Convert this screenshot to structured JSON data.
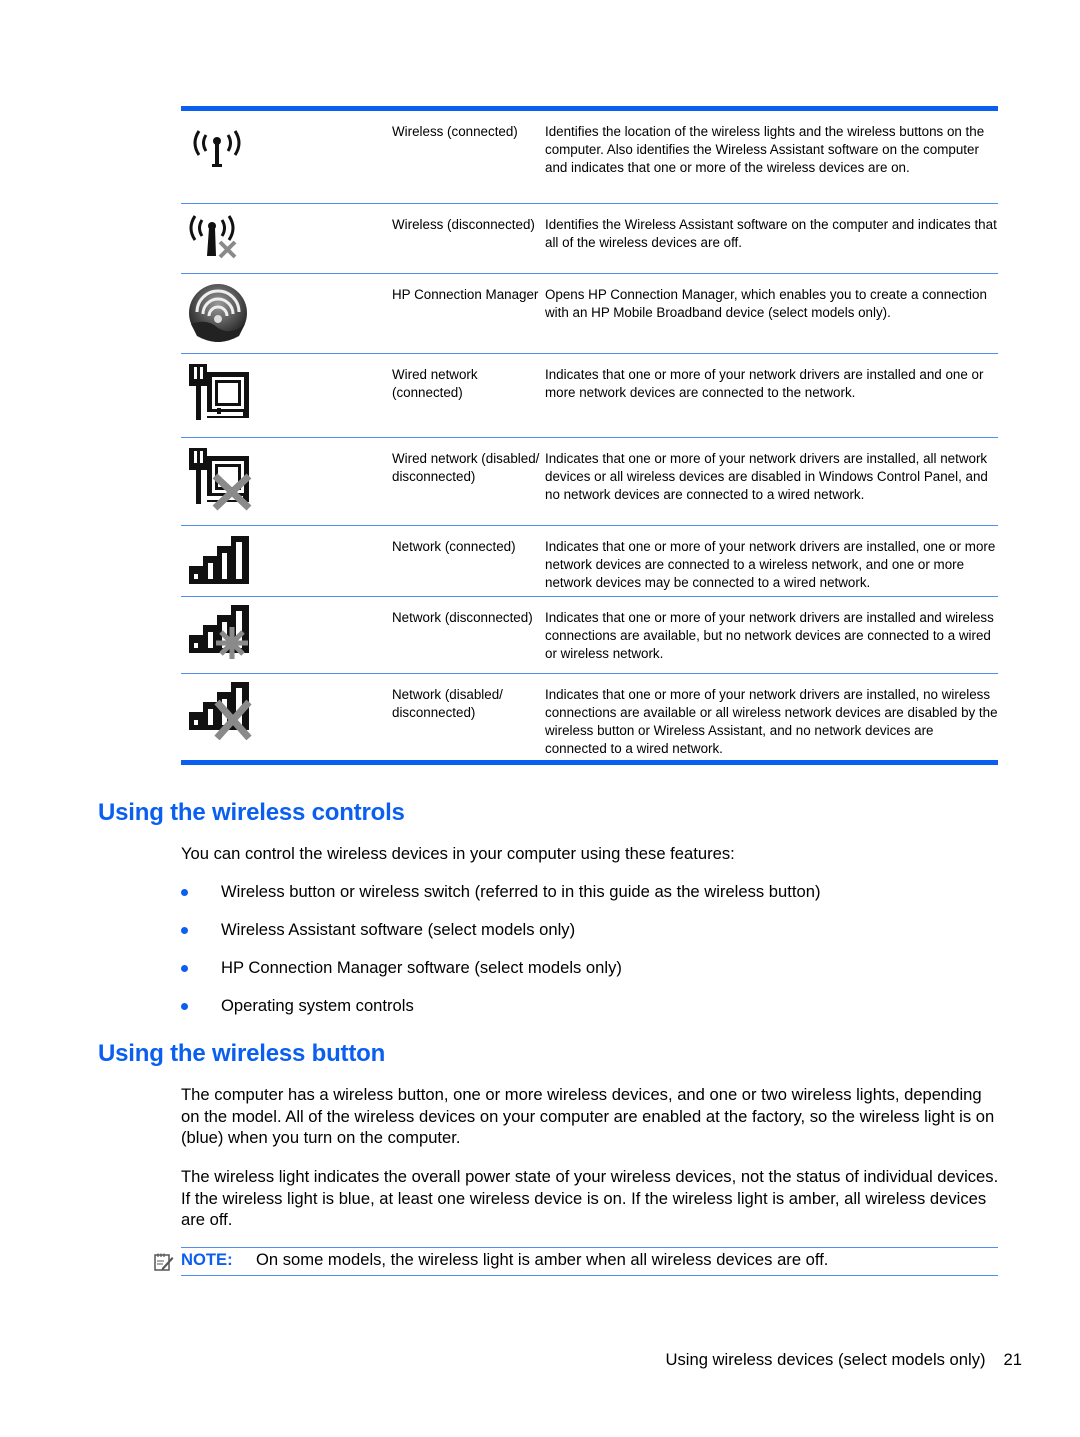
{
  "table": {
    "rows": [
      {
        "icon": "wireless-connected-icon",
        "name": "Wireless (connected)",
        "description": "Identifies the location of the wireless lights and the wireless buttons on the computer. Also identifies the Wireless Assistant software on the computer and indicates that one or more of the wireless devices are on."
      },
      {
        "icon": "wireless-disconnected-icon",
        "name": "Wireless (disconnected)",
        "description": "Identifies the Wireless Assistant software on the computer and indicates that all of the wireless devices are off."
      },
      {
        "icon": "hp-connection-manager-icon",
        "name": "HP Connection Manager",
        "description": "Opens HP Connection Manager, which enables you to create a connection with an HP Mobile Broadband device (select models only)."
      },
      {
        "icon": "wired-network-connected-icon",
        "name": "Wired network (connected)",
        "description": "Indicates that one or more of your network drivers are installed and one or more network devices are connected to the network."
      },
      {
        "icon": "wired-network-disabled-icon",
        "name": "Wired network (disabled/ disconnected)",
        "description": "Indicates that one or more of your network drivers are installed, all network devices or all wireless devices are disabled in Windows Control Panel, and no network devices are connected to a wired network."
      },
      {
        "icon": "network-connected-icon",
        "name": "Network (connected)",
        "description": "Indicates that one or more of your network drivers are installed, one or more network devices are connected to a wireless network, and one or more network devices may be connected to a wired network."
      },
      {
        "icon": "network-disconnected-icon",
        "name": "Network (disconnected)",
        "description": "Indicates that one or more of your network drivers are installed and wireless connections are available, but no network devices are connected to a wired or wireless network."
      },
      {
        "icon": "network-disabled-icon",
        "name": "Network (disabled/ disconnected)",
        "description": "Indicates that one or more of your network drivers are installed, no wireless connections are available or all wireless network devices are disabled by the wireless button or Wireless Assistant, and no network devices are connected to a wired network."
      }
    ]
  },
  "section1": {
    "heading": "Using the wireless controls",
    "intro": "You can control the wireless devices in your computer using these features:",
    "bullets": [
      "Wireless button or wireless switch (referred to in this guide as the wireless button)",
      "Wireless Assistant software (select models only)",
      "HP Connection Manager software (select models only)",
      "Operating system controls"
    ]
  },
  "section2": {
    "heading": "Using the wireless button",
    "para1": "The computer has a wireless button, one or more wireless devices, and one or two wireless lights, depending on the model. All of the wireless devices on your computer are enabled at the factory, so the wireless light is on (blue) when you turn on the computer.",
    "para2": "The wireless light indicates the overall power state of your wireless devices, not the status of individual devices. If the wireless light is blue, at least one wireless device is on. If the wireless light is amber, all wireless devices are off.",
    "note_label": "NOTE:",
    "note_text": "On some models, the wireless light is amber when all wireless devices are off."
  },
  "footer": {
    "title": "Using wireless devices (select models only)",
    "page": "21"
  },
  "colors": {
    "accent": "#0a5ff0",
    "rule": "#4f8ef2",
    "icon_gray": "#8a8a8a"
  }
}
